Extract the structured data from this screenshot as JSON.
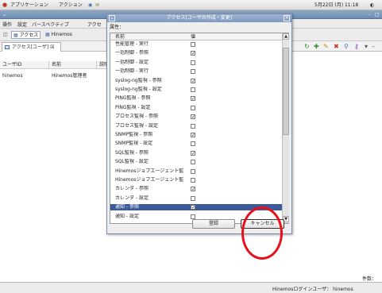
{
  "os_topbar": {
    "applications": "アプリケーション",
    "actions": "アクション",
    "datetime": "5月22日 (月) 11:18"
  },
  "menubar": {
    "items": [
      "操作",
      "設定",
      "パースペクティブ",
      "アクセ"
    ]
  },
  "toolbar": {
    "perspective_access": "アクセス",
    "perspective_hinemos": "Hinemos"
  },
  "view": {
    "tab_label": "アクセス[ユーザ] ☒",
    "columns": [
      "ユーザID",
      "名前",
      "説明"
    ],
    "row": {
      "id": "hinemos",
      "name": "Hinemos管理者"
    }
  },
  "status": {
    "count_label": "件数：",
    "login_user": "Hinemosログインユーザ： hinemos"
  },
  "dialog": {
    "title": "アクセス[ユーザの作成・変更]",
    "attr_label": "属性：",
    "col_name": "名前",
    "col_value": "値",
    "rows": [
      {
        "name": "性能管理 - 実行",
        "checked": false,
        "selected": false
      },
      {
        "name": "一括制御 - 参照",
        "checked": true,
        "selected": false
      },
      {
        "name": "一括制御 - 設定",
        "checked": false,
        "selected": false
      },
      {
        "name": "一括制御 - 実行",
        "checked": false,
        "selected": false
      },
      {
        "name": "syslog-ng監視 - 参照",
        "checked": true,
        "selected": false
      },
      {
        "name": "syslog-ng監視 - 設定",
        "checked": false,
        "selected": false
      },
      {
        "name": "PING監視 - 参照",
        "checked": true,
        "selected": false
      },
      {
        "name": "PING監視 - 設定",
        "checked": false,
        "selected": false
      },
      {
        "name": "プロセス監視 - 参照",
        "checked": true,
        "selected": false
      },
      {
        "name": "プロセス監視 - 設定",
        "checked": false,
        "selected": false
      },
      {
        "name": "SNMP監視 - 参照",
        "checked": true,
        "selected": false
      },
      {
        "name": "SNMP監視 - 設定",
        "checked": false,
        "selected": false
      },
      {
        "name": "SQL監視 - 参照",
        "checked": true,
        "selected": false
      },
      {
        "name": "SQL監視 - 設定",
        "checked": false,
        "selected": false
      },
      {
        "name": "Hinemosジョブエージェント監",
        "checked": false,
        "selected": false
      },
      {
        "name": "Hinemosジョブエージェント監",
        "checked": false,
        "selected": false
      },
      {
        "name": "カレンダ - 参照",
        "checked": true,
        "selected": false
      },
      {
        "name": "カレンダ - 設定",
        "checked": false,
        "selected": false
      },
      {
        "name": "通知 - 参照",
        "checked": true,
        "selected": true
      },
      {
        "name": "通知 - 設定",
        "checked": false,
        "selected": false
      }
    ],
    "register_button": "登録",
    "cancel_button": "キャンセル"
  },
  "colors": {
    "selection": "#3b5a9b",
    "annotation_circle": "#e8101a",
    "title_bar": "#7f99c0"
  }
}
